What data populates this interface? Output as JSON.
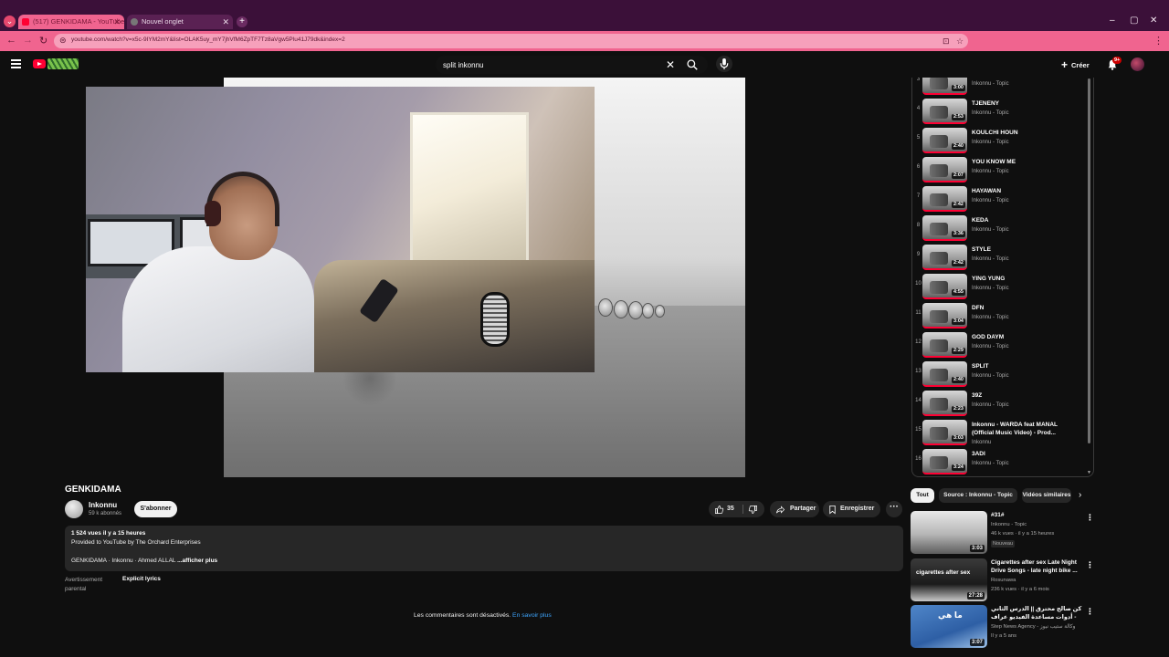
{
  "browser": {
    "tabs": [
      {
        "label": "(517) GENKIDAMA - YouTube",
        "active": true
      },
      {
        "label": "Nouvel onglet",
        "active": false
      }
    ],
    "url": "youtube.com/watch?v=x5c-9IYM2mY&list=OLAK5uy_mY7jhVfM6ZpTF7Tz8aVgw5Plu41J79dk&index=2",
    "accent_color": "#f0648f"
  },
  "masthead": {
    "search_value": "split inkonnu",
    "create_label": "Créer",
    "notification_badge": "9+"
  },
  "video": {
    "title": "GENKIDAMA",
    "channel": "Inkonnu",
    "subscribers": "59 k abonnés",
    "subscribe_label": "S'abonner",
    "likes": "35",
    "share_label": "Partager",
    "save_label": "Enregistrer",
    "description": {
      "meta": "1 524 vues  il y a 15 heures",
      "line1": "Provided to YouTube by The Orchard Enterprises",
      "line2": "GENKIDAMA · Inkonnu · Ahmed ALLAL",
      "more_label": "...afficher plus"
    },
    "advisory_label": "Avertissement parental",
    "advisory_value": "Explicit lyrics",
    "comments_off": "Les commentaires sont désactivés.",
    "comments_link": "En savoir plus"
  },
  "playlist": {
    "items": [
      {
        "index": "3",
        "title": "",
        "channel": "Inkonnu - Topic",
        "duration": "3:00"
      },
      {
        "index": "4",
        "title": "TJENENY",
        "channel": "Inkonnu - Topic",
        "duration": "2:53"
      },
      {
        "index": "5",
        "title": "KOULCHI HOUN",
        "channel": "Inkonnu - Topic",
        "duration": "2:40"
      },
      {
        "index": "6",
        "title": "YOU KNOW ME",
        "channel": "Inkonnu - Topic",
        "duration": "2:07"
      },
      {
        "index": "7",
        "title": "HAYAWAN",
        "channel": "Inkonnu - Topic",
        "duration": "2:42"
      },
      {
        "index": "8",
        "title": "KEDA",
        "channel": "Inkonnu - Topic",
        "duration": "3:36"
      },
      {
        "index": "9",
        "title": "STYLE",
        "channel": "Inkonnu - Topic",
        "duration": "2:42"
      },
      {
        "index": "10",
        "title": "YING YUNG",
        "channel": "Inkonnu - Topic",
        "duration": "4:55"
      },
      {
        "index": "11",
        "title": "DFN",
        "channel": "Inkonnu - Topic",
        "duration": "3:04"
      },
      {
        "index": "12",
        "title": "GOD DAYM",
        "channel": "Inkonnu - Topic",
        "duration": "2:29"
      },
      {
        "index": "13",
        "title": "SPLIT",
        "channel": "Inkonnu - Topic",
        "duration": "2:40"
      },
      {
        "index": "14",
        "title": "39Z",
        "channel": "Inkonnu - Topic",
        "duration": "2:23"
      },
      {
        "index": "15",
        "title": "Inkonnu - WARDA feat MANAL (Official Music Video) - Prod...",
        "channel": "Inkonnu",
        "duration": "3:03"
      },
      {
        "index": "16",
        "title": "3ADI",
        "channel": "Inkonnu - Topic",
        "duration": "3:24"
      }
    ]
  },
  "chips": [
    "Tout",
    "Source : Inkonnu - Topic",
    "Vidéos similaires"
  ],
  "recommendations": [
    {
      "title": "#31#",
      "channel": "Inkonnu - Topic",
      "meta": "46 k vues · il y a 15 heures",
      "badge": "Nouveau",
      "duration": "3:03",
      "thumb_text": ""
    },
    {
      "title": "Cigarettes after sex Late Night Drive Songs - late night bike ...",
      "channel": "Rosunawa",
      "meta": "236 k vues · il y a 6 mois",
      "badge": "",
      "duration": "27:28",
      "thumb_text": "cigarettes after sex"
    },
    {
      "title": "كن صالح محترق || الدرس الثاني - أدوات مساعدة الفيديو عراف",
      "channel": "Step News Agency - وكالة ستيب نيوز",
      "meta": "Il y a 5 ans",
      "badge": "",
      "duration": "3:07",
      "thumb_text": "ما هي"
    }
  ]
}
